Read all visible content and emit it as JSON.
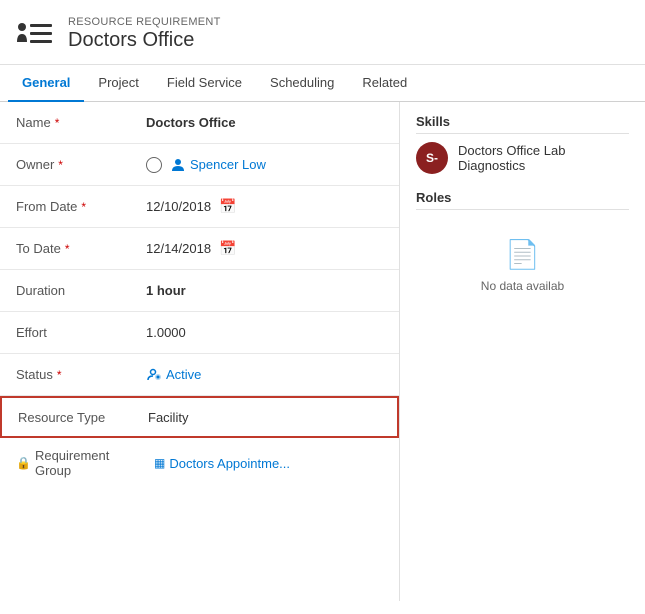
{
  "header": {
    "subtitle": "RESOURCE REQUIREMENT",
    "title": "Doctors Office"
  },
  "tabs": [
    {
      "id": "general",
      "label": "General",
      "active": true
    },
    {
      "id": "project",
      "label": "Project",
      "active": false
    },
    {
      "id": "field-service",
      "label": "Field Service",
      "active": false
    },
    {
      "id": "scheduling",
      "label": "Scheduling",
      "active": false
    },
    {
      "id": "related",
      "label": "Related",
      "active": false
    }
  ],
  "form": {
    "name_label": "Name",
    "name_value": "Doctors Office",
    "owner_label": "Owner",
    "owner_value": "Spencer Low",
    "from_date_label": "From Date",
    "from_date_value": "12/10/2018",
    "to_date_label": "To Date",
    "to_date_value": "12/14/2018",
    "duration_label": "Duration",
    "duration_value": "1 hour",
    "effort_label": "Effort",
    "effort_value": "1.0000",
    "status_label": "Status",
    "status_value": "Active",
    "resource_type_label": "Resource Type",
    "resource_type_value": "Facility",
    "req_group_label": "Requirement Group",
    "req_group_value": "Doctors Appointme..."
  },
  "right_panel": {
    "skills_title": "Skills",
    "skill_avatar_initials": "S-",
    "skill_name": "Doctors Office Lab Diagnostics",
    "roles_title": "Roles",
    "no_data_text": "No data availab"
  }
}
